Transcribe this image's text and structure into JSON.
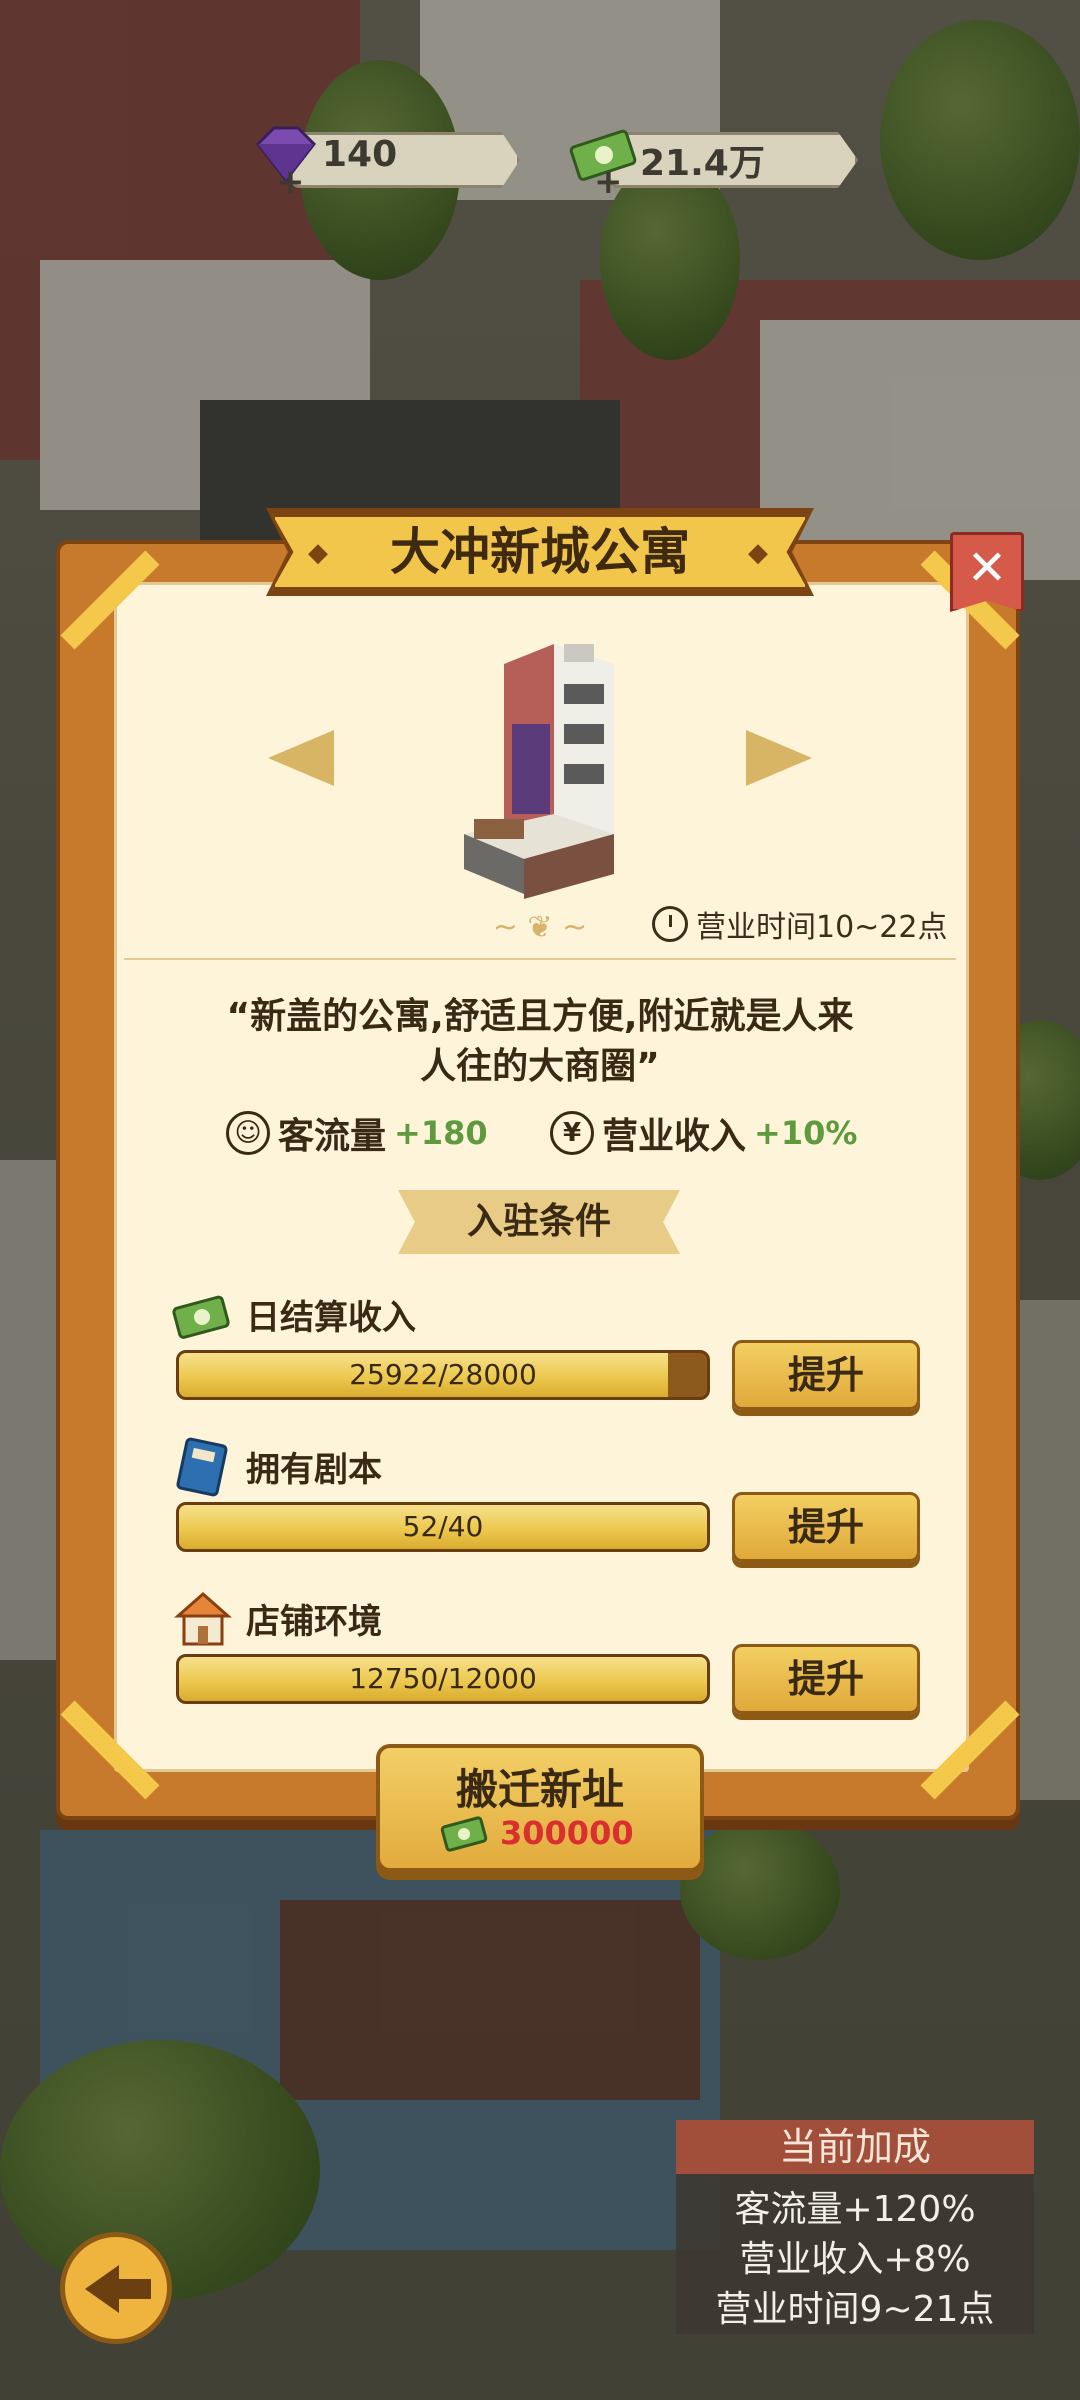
{
  "currency": {
    "gems": "140",
    "cash": "21.4万",
    "gem_icon": "gem-icon",
    "cash_icon": "cash-icon"
  },
  "modal": {
    "title": "大冲新城公寓",
    "close_label": "✕",
    "hours": "营业时间10~22点",
    "description_line1": "“新盖的公寓,舒适且方便,附近就是人来",
    "description_line2": "人往的大商圈”",
    "stats": [
      {
        "label": "客流量",
        "bonus": "+180",
        "icon": "visitors-icon"
      },
      {
        "label": "营业收入",
        "bonus": "+10%",
        "icon": "yen-icon"
      }
    ],
    "requirements_title": "入驻条件",
    "requirements": [
      {
        "label": "日结算收入",
        "progress_text": "25922/28000",
        "progress": 0.926,
        "button": "提升",
        "icon": "cash-stack-icon"
      },
      {
        "label": "拥有剧本",
        "progress_text": "52/40",
        "progress": 1.0,
        "button": "提升",
        "icon": "script-book-icon"
      },
      {
        "label": "店铺环境",
        "progress_text": "12750/12000",
        "progress": 1.0,
        "button": "提升",
        "icon": "shop-house-icon"
      }
    ],
    "relocate": {
      "label": "搬迁新址",
      "cost": "300000"
    }
  },
  "bonus_panel": {
    "title": "当前加成",
    "lines": [
      "客流量+120%",
      "营业收入+8%",
      "营业时间9~21点"
    ]
  },
  "colors": {
    "frame": "#c87a2c",
    "parchment": "#fdf4da",
    "accent_gold": "#f1c64a",
    "bonus_green": "#5f9a3f",
    "cost_red": "#d92f2f",
    "close_red": "#d55a4a"
  }
}
